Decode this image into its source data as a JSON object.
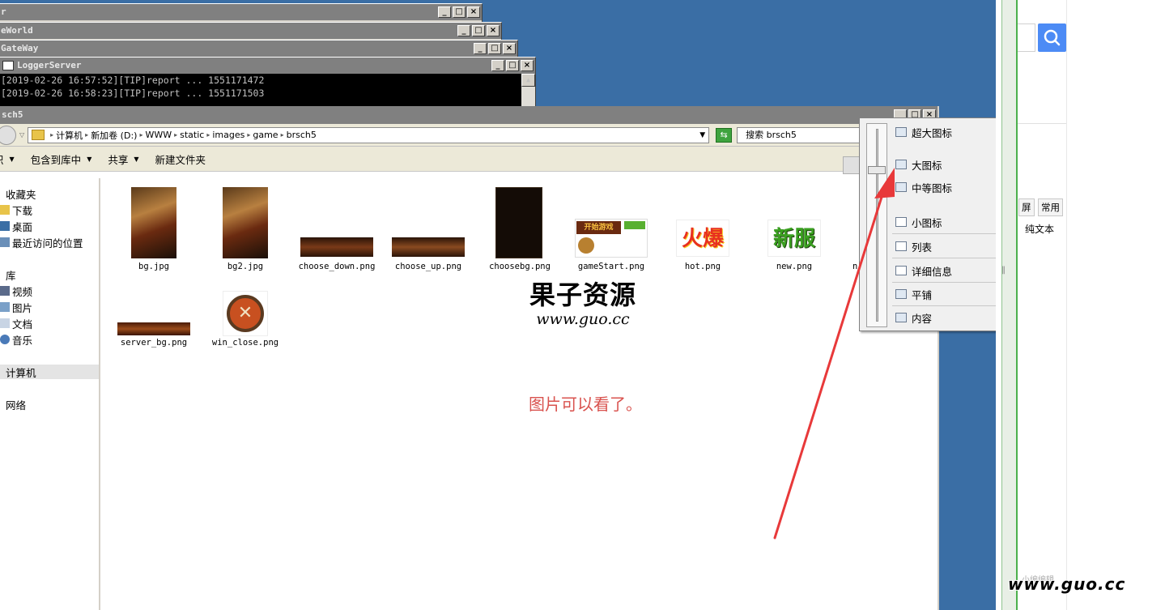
{
  "console_windows": [
    {
      "title": "r"
    },
    {
      "title": "eWorld"
    },
    {
      "title": "GateWay"
    },
    {
      "title": "LoggerServer",
      "lines": [
        "[2019-02-26 16:57:52][TIP]report ... 1551171472",
        "[2019-02-26 16:58:23][TIP]report ... 1551171503"
      ]
    }
  ],
  "window_buttons": {
    "minimize": "_",
    "maximize": "□",
    "close": "×"
  },
  "explorer": {
    "title": "sch5",
    "breadcrumb": [
      "计算机",
      "新加卷 (D:)",
      "WWW",
      "static",
      "images",
      "game",
      "brsch5"
    ],
    "search_placeholder": "搜索 brsch5",
    "toolbar": {
      "organize": "织",
      "include_library": "包含到库中",
      "share": "共享",
      "new_folder": "新建文件夹"
    },
    "nav": {
      "favorites": "收藏夹",
      "downloads": "下载",
      "desktop": "桌面",
      "recent": "最近访问的位置",
      "libraries": "库",
      "videos": "视频",
      "pictures": "图片",
      "documents": "文档",
      "music": "音乐",
      "computer": "计算机",
      "network": "网络"
    },
    "files": [
      {
        "name": "bg.jpg"
      },
      {
        "name": "bg2.jpg"
      },
      {
        "name": "choose_down.png"
      },
      {
        "name": "choose_up.png"
      },
      {
        "name": "choosebg.png"
      },
      {
        "name": "gameStart.png"
      },
      {
        "name": "hot.png"
      },
      {
        "name": "new.png"
      },
      {
        "name": "n"
      },
      {
        "name": "server_bg.png"
      },
      {
        "name": "win_close.png"
      }
    ],
    "thumb_texts": {
      "game_start": "开始游戏",
      "hot": "火爆",
      "new": "新服"
    }
  },
  "view_menu": {
    "items": [
      "超大图标",
      "大图标",
      "中等图标",
      "小图标",
      "列表",
      "详细信息",
      "平铺",
      "内容"
    ],
    "slider_value": "大图标"
  },
  "watermark": {
    "name": "果子资源",
    "url": "www.guo.cc"
  },
  "annotation": "图片可以看了。",
  "bottom_watermark": "www.guo.cc",
  "right_panel": {
    "tabs": [
      "屏",
      "常用"
    ],
    "plain_text": "纯文本",
    "bottom_text": "小编编辑"
  },
  "colors": {
    "desktop": "#3a6ea5",
    "arrow": "#e8393a",
    "annotation": "#d9534f",
    "search_button": "#4c8bf5"
  }
}
